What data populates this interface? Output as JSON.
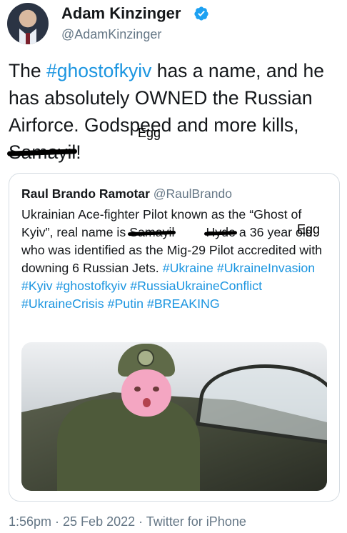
{
  "author": {
    "name": "Adam Kinzinger",
    "handle": "@AdamKinzinger",
    "verified_icon": "verified-badge-icon",
    "verified_color": "#1da1f2"
  },
  "tweet": {
    "line1_a": "The ",
    "hashtag1": "#ghostofkyiv",
    "line1_b": " has a name, and he has absolutely OWNED the Russian Airforce.  Godspeed and more kills, ",
    "redacted": "Samayil",
    "end": "!",
    "overlay_label": "Egg"
  },
  "quote": {
    "author_name": "Raul Brando Ramotar",
    "author_handle": "@RaulBrando",
    "text_a": "Ukrainian Ace-fighter Pilot known as the “Ghost of Kyiv”, real name is ",
    "redacted1": "Samayil",
    "overlay1": "Egg",
    "redacted2": "Hyde",
    "text_b": " a 36 year old who was identified as the Mig-29 Pilot accredited with downing 6 Russian Jets. ",
    "hashtags": [
      "#Ukraine",
      "#UkraineInvasion",
      "#Kyiv",
      "#ghostofkyiv",
      "#RussiaUkraineConflict",
      "#UkraineCrisis",
      "#Putin",
      "#BREAKING"
    ]
  },
  "footer": {
    "meta": "1:56pm · 25 Feb 2022 · Twitter for iPhone"
  },
  "colors": {
    "link": "#1b95e0",
    "secondary_text": "#657786",
    "border": "#d6dde3"
  }
}
